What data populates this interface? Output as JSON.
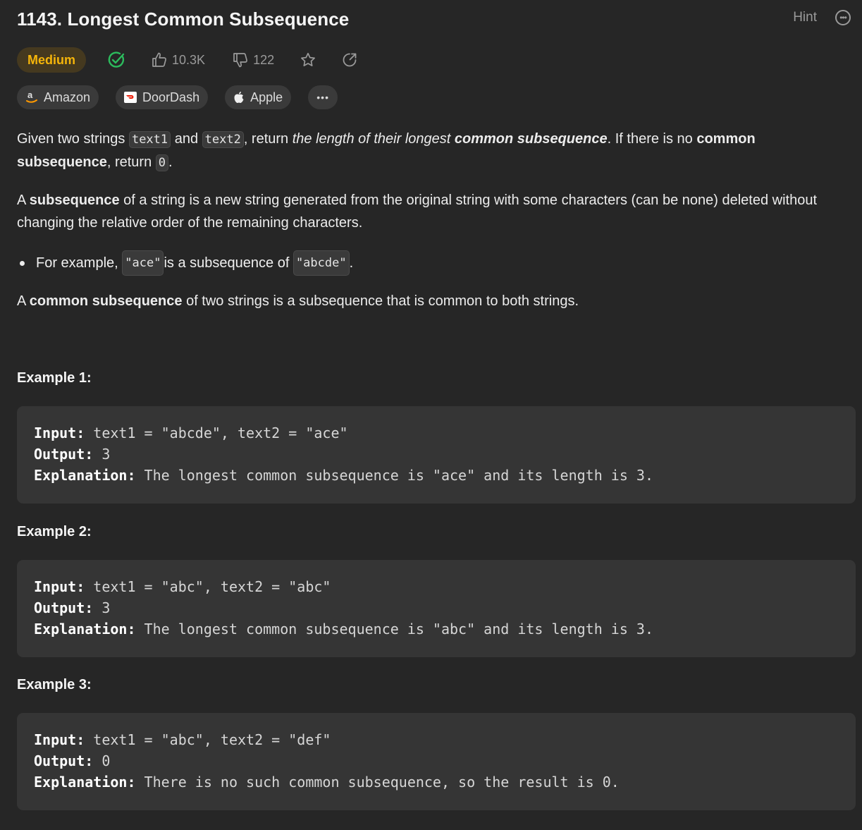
{
  "problem": {
    "title": "1143. Longest Common Subsequence",
    "hint_label": "Hint",
    "difficulty": "Medium",
    "likes": "10.3K",
    "dislikes": "122"
  },
  "companies": [
    {
      "name": "Amazon",
      "icon": "amazon-icon"
    },
    {
      "name": "DoorDash",
      "icon": "doordash-icon"
    },
    {
      "name": "Apple",
      "icon": "apple-icon"
    }
  ],
  "description": {
    "p1": {
      "t1": "Given two strings ",
      "c1": "text1",
      "t2": " and ",
      "c2": "text2",
      "t3": ", return ",
      "i1": "the length of their longest ",
      "bi1": "common subsequence",
      "t4": ". If there is no ",
      "b1": "common subsequence",
      "t5": ", return ",
      "c3": "0",
      "t6": "."
    },
    "p2": {
      "t1": "A ",
      "b1": "subsequence",
      "t2": " of a string is a new string generated from the original string with some characters (can be none) deleted without changing the relative order of the remaining characters."
    },
    "bullet": {
      "t1": "For example, ",
      "c1": "\"ace\"",
      "t2": " is a subsequence of ",
      "c2": "\"abcde\"",
      "t3": "."
    },
    "p3": {
      "t1": "A ",
      "b1": "common subsequence",
      "t2": " of two strings is a subsequence that is common to both strings."
    }
  },
  "examples": [
    {
      "title": "Example 1:",
      "input_label": "Input:",
      "input": " text1 = \"abcde\", text2 = \"ace\"",
      "output_label": "Output:",
      "output": " 3",
      "explanation_label": "Explanation:",
      "explanation": " The longest common subsequence is \"ace\" and its length is 3."
    },
    {
      "title": "Example 2:",
      "input_label": "Input:",
      "input": " text1 = \"abc\", text2 = \"abc\"",
      "output_label": "Output:",
      "output": " 3",
      "explanation_label": "Explanation:",
      "explanation": " The longest common subsequence is \"abc\" and its length is 3."
    },
    {
      "title": "Example 3:",
      "input_label": "Input:",
      "input": " text1 = \"abc\", text2 = \"def\"",
      "output_label": "Output:",
      "output": " 0",
      "explanation_label": "Explanation:",
      "explanation": " There is no such common subsequence, so the result is 0."
    }
  ],
  "colors": {
    "background": "#262626",
    "difficulty_text": "#f5b50a",
    "difficulty_bg": "#45391f",
    "solved_check": "#2cbb5d"
  }
}
